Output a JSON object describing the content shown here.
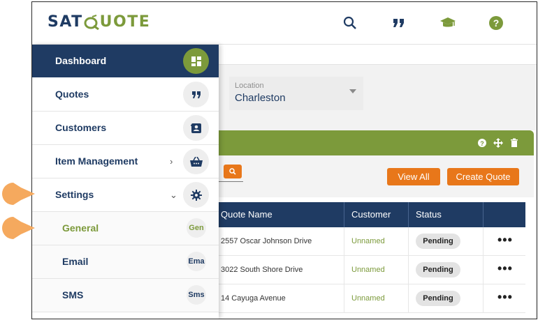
{
  "brand": {
    "logo_left": "SAT",
    "logo_right": "UOTE",
    "primary_color": "#1f3b63",
    "accent_color": "#7c9a3b",
    "action_color": "#e8771a"
  },
  "topbar": {
    "icons": [
      "search-icon",
      "quotes-icon",
      "graduation-cap-icon",
      "help-icon"
    ]
  },
  "sidebar": {
    "items": [
      {
        "label": "Dashboard",
        "icon": "dashboard-grid-icon",
        "active": true
      },
      {
        "label": "Quotes",
        "icon": "quote-marks-icon"
      },
      {
        "label": "Customers",
        "icon": "contact-card-icon"
      },
      {
        "label": "Item Management",
        "icon": "basket-icon",
        "chevron": "›"
      },
      {
        "label": "Settings",
        "icon": "gear-icon",
        "chevron": "⌄"
      }
    ],
    "subitems": [
      {
        "label": "General",
        "badge": "Gen"
      },
      {
        "label": "Email",
        "badge": "Ema"
      },
      {
        "label": "SMS",
        "badge": "Sms"
      }
    ]
  },
  "filters": {
    "location_label": "Location",
    "location_value": "Charleston"
  },
  "toolbar": {
    "view_all": "View All",
    "create_quote": "Create Quote"
  },
  "table": {
    "headers": [
      "Quote Name",
      "Customer",
      "Status"
    ],
    "rows": [
      {
        "name": "2557 Oscar Johnson Drive",
        "customer": "Unnamed",
        "status": "Pending"
      },
      {
        "name": "3022 South Shore Drive",
        "customer": "Unnamed",
        "status": "Pending"
      },
      {
        "name": "14 Cayuga Avenue",
        "customer": "Unnamed",
        "status": "Pending"
      }
    ],
    "row_action": "•••"
  }
}
